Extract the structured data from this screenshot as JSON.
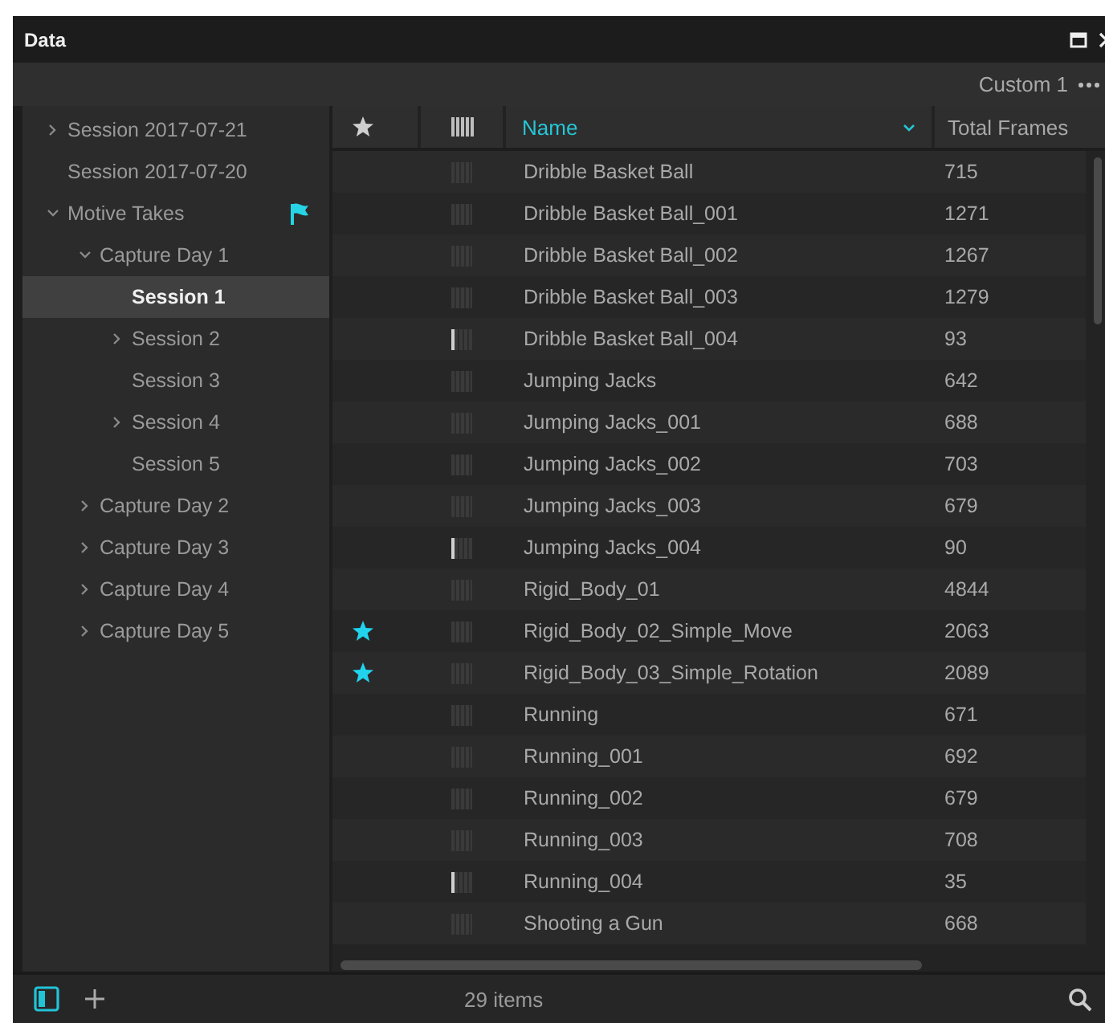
{
  "window": {
    "title": "Data"
  },
  "toolbar": {
    "layout_label": "Custom 1"
  },
  "tree": [
    {
      "label": "Session 2017-07-21",
      "kind": "group",
      "expanded": false,
      "selected": false,
      "flagged": false
    },
    {
      "label": "Session 2017-07-20",
      "kind": "leaf",
      "selected": false,
      "flagged": false
    },
    {
      "label": "Motive Takes",
      "kind": "group",
      "expanded": true,
      "selected": false,
      "flagged": true,
      "children": [
        {
          "label": "Capture Day 1",
          "kind": "group",
          "expanded": true,
          "selected": false,
          "flagged": false,
          "children": [
            {
              "label": "Session 1",
              "kind": "leaf",
              "selected": true,
              "flagged": false
            },
            {
              "label": "Session 2",
              "kind": "group",
              "expanded": false,
              "selected": false,
              "flagged": false
            },
            {
              "label": "Session 3",
              "kind": "leaf",
              "selected": false,
              "flagged": false
            },
            {
              "label": "Session 4",
              "kind": "group",
              "expanded": false,
              "selected": false,
              "flagged": false
            },
            {
              "label": "Session 5",
              "kind": "leaf",
              "selected": false,
              "flagged": false
            }
          ]
        },
        {
          "label": "Capture Day 2",
          "kind": "group",
          "expanded": false,
          "selected": false,
          "flagged": false
        },
        {
          "label": "Capture Day 3",
          "kind": "group",
          "expanded": false,
          "selected": false,
          "flagged": false
        },
        {
          "label": "Capture Day 4",
          "kind": "group",
          "expanded": false,
          "selected": false,
          "flagged": false
        },
        {
          "label": "Capture Day 5",
          "kind": "group",
          "expanded": false,
          "selected": false,
          "flagged": false
        }
      ]
    }
  ],
  "table": {
    "columns": [
      {
        "kind": "star"
      },
      {
        "kind": "progress"
      },
      {
        "kind": "text",
        "label": "Name",
        "sorted": true
      },
      {
        "kind": "text",
        "label": "Total Frames",
        "sorted": false
      }
    ],
    "rows": [
      {
        "starred": false,
        "marked": false,
        "name": "Dribble Basket Ball",
        "total_frames": "715"
      },
      {
        "starred": false,
        "marked": false,
        "name": "Dribble Basket Ball_001",
        "total_frames": "1271"
      },
      {
        "starred": false,
        "marked": false,
        "name": "Dribble Basket Ball_002",
        "total_frames": "1267"
      },
      {
        "starred": false,
        "marked": false,
        "name": "Dribble Basket Ball_003",
        "total_frames": "1279"
      },
      {
        "starred": false,
        "marked": true,
        "name": "Dribble Basket Ball_004",
        "total_frames": "93"
      },
      {
        "starred": false,
        "marked": false,
        "name": "Jumping Jacks",
        "total_frames": "642"
      },
      {
        "starred": false,
        "marked": false,
        "name": "Jumping Jacks_001",
        "total_frames": "688"
      },
      {
        "starred": false,
        "marked": false,
        "name": "Jumping Jacks_002",
        "total_frames": "703"
      },
      {
        "starred": false,
        "marked": false,
        "name": "Jumping Jacks_003",
        "total_frames": "679"
      },
      {
        "starred": false,
        "marked": true,
        "name": "Jumping Jacks_004",
        "total_frames": "90"
      },
      {
        "starred": false,
        "marked": false,
        "name": "Rigid_Body_01",
        "total_frames": "4844"
      },
      {
        "starred": true,
        "marked": false,
        "name": "Rigid_Body_02_Simple_Move",
        "total_frames": "2063"
      },
      {
        "starred": true,
        "marked": false,
        "name": "Rigid_Body_03_Simple_Rotation",
        "total_frames": "2089"
      },
      {
        "starred": false,
        "marked": false,
        "name": "Running",
        "total_frames": "671"
      },
      {
        "starred": false,
        "marked": false,
        "name": "Running_001",
        "total_frames": "692"
      },
      {
        "starred": false,
        "marked": false,
        "name": "Running_002",
        "total_frames": "679"
      },
      {
        "starred": false,
        "marked": false,
        "name": "Running_003",
        "total_frames": "708"
      },
      {
        "starred": false,
        "marked": true,
        "name": "Running_004",
        "total_frames": "35"
      },
      {
        "starred": false,
        "marked": false,
        "name": "Shooting a Gun",
        "total_frames": "668"
      }
    ]
  },
  "status_bar": {
    "count": "29 items"
  }
}
